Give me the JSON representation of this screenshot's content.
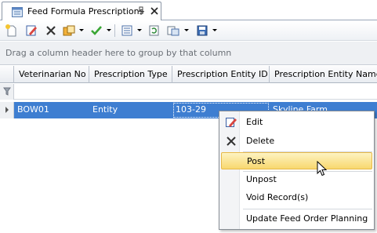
{
  "tab": {
    "title": "Feed Formula Prescriptions"
  },
  "group_panel": {
    "hint": "Drag a column header here to group by that column"
  },
  "grid": {
    "columns": [
      "Veterinarian No",
      "Prescription Type",
      "Prescription Entity ID",
      "Prescription Entity Name"
    ],
    "rows": [
      [
        "BOW01",
        "Entity",
        "103-29",
        "Skyline Farm"
      ]
    ]
  },
  "context_menu": {
    "items": [
      "Edit",
      "Delete",
      "Post",
      "Unpost",
      "Void Record(s)",
      "Update Feed Order Planning"
    ],
    "highlighted": "Post"
  },
  "colors": {
    "selection": "#3e7ed1",
    "highlight": "#f8d86f"
  }
}
